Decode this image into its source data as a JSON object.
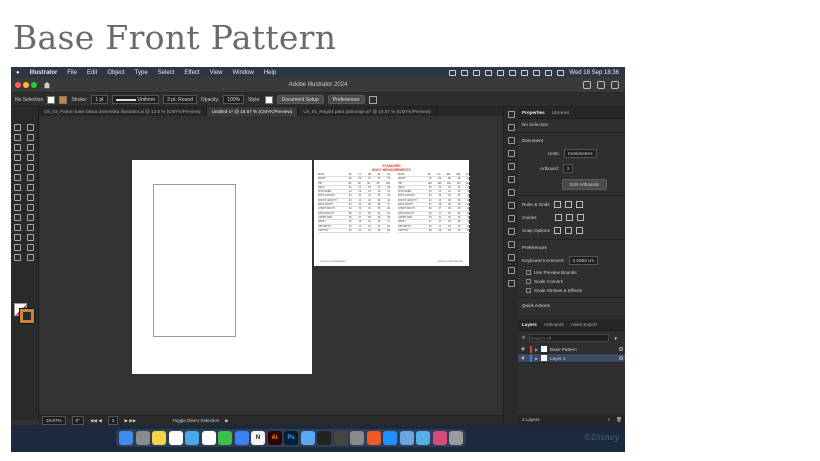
{
  "slide": {
    "title": "Base Front Pattern"
  },
  "menubar": {
    "app_name": "Illustrator",
    "items": [
      "File",
      "Edit",
      "Object",
      "Type",
      "Select",
      "Effect",
      "View",
      "Window",
      "Help"
    ],
    "clock": "Wed 18 Sep  18:36"
  },
  "titlebar": {
    "title": "Adobe Illustrator 2024"
  },
  "controlbar": {
    "selection": "No Selection",
    "stroke_label": "Stroke:",
    "stroke_weight": "1 pt",
    "stroke_profile": "Uniform",
    "brush": "3 pt. Round",
    "opacity_label": "Opacity:",
    "opacity": "100%",
    "style_label": "Style:",
    "document_setup": "Document Setup",
    "preferences": "Preferences"
  },
  "tabs": [
    {
      "label": "U5_03_Patron base blusa domestika illustrator.ai @ 12.5 % (CMYK/Preview)",
      "active": false
    },
    {
      "label": "Untitled-1* @ 16.67 % (CMYK/Preview)",
      "active": true
    },
    {
      "label": "U4_01_Reglas para patronaje.ai* @ 16.67 % (CMYK/Preview)",
      "active": false
    }
  ],
  "artboard2": {
    "title_line1": "STANDARD",
    "title_line2": "BODY MEASUREMENTS",
    "left_rows": [
      [
        "BUST",
        "80",
        "84",
        "88",
        "92",
        "96"
      ],
      [
        "WAIST",
        "62",
        "66",
        "70",
        "74",
        "78"
      ],
      [
        "HIP",
        "86",
        "90",
        "94",
        "98",
        "102"
      ],
      [
        "NECK",
        "34",
        "35",
        "36",
        "37",
        "38"
      ],
      [
        "SHOULDER",
        "12",
        "12",
        "13",
        "13",
        "13"
      ],
      [
        "BACK LENGTH",
        "40",
        "41",
        "41",
        "42",
        "42"
      ],
      [
        "FRONT LENGTH",
        "42",
        "43",
        "43",
        "44",
        "44"
      ],
      [
        "BACK WIDTH",
        "33",
        "34",
        "35",
        "36",
        "37"
      ],
      [
        "CHEST WIDTH",
        "32",
        "33",
        "34",
        "35",
        "36"
      ],
      [
        "ARM LENGTH",
        "58",
        "59",
        "60",
        "61",
        "62"
      ],
      [
        "UPPER ARM",
        "26",
        "27",
        "28",
        "29",
        "30"
      ],
      [
        "WRIST",
        "15",
        "15",
        "16",
        "16",
        "17"
      ],
      [
        "HIP DEPTH",
        "20",
        "20",
        "21",
        "21",
        "22"
      ],
      [
        "CROTCH",
        "26",
        "27",
        "27",
        "28",
        "28"
      ]
    ],
    "right_rows": [
      [
        "BUST",
        "96",
        "100",
        "104",
        "108",
        "112"
      ],
      [
        "WAIST",
        "78",
        "82",
        "86",
        "90",
        "94"
      ],
      [
        "HIP",
        "102",
        "106",
        "110",
        "114",
        "118"
      ],
      [
        "NECK",
        "38",
        "39",
        "40",
        "41",
        "42"
      ],
      [
        "SHOULDER",
        "13",
        "14",
        "14",
        "14",
        "15"
      ],
      [
        "BACK LENGTH",
        "42",
        "43",
        "43",
        "44",
        "44"
      ],
      [
        "FRONT LENGTH",
        "44",
        "45",
        "45",
        "46",
        "46"
      ],
      [
        "BACK WIDTH",
        "37",
        "38",
        "39",
        "40",
        "41"
      ],
      [
        "CHEST WIDTH",
        "36",
        "37",
        "38",
        "39",
        "40"
      ],
      [
        "ARM LENGTH",
        "62",
        "62",
        "63",
        "63",
        "64"
      ],
      [
        "UPPER ARM",
        "30",
        "31",
        "32",
        "33",
        "34"
      ],
      [
        "WRIST",
        "17",
        "17",
        "18",
        "18",
        "19"
      ],
      [
        "HIP DEPTH",
        "22",
        "22",
        "23",
        "23",
        "24"
      ],
      [
        "CROTCH",
        "28",
        "29",
        "29",
        "30",
        "30"
      ]
    ],
    "footer_left": "SIZES IN CENTIMETERS",
    "footer_right": "SIZES IN CENTIMETERS"
  },
  "statusbar": {
    "zoom": "16.67%",
    "rotation": "0°",
    "artboard_num": "2",
    "tool": "Toggle Direct Selection"
  },
  "properties": {
    "tab_properties": "Properties",
    "tab_libraries": "Libraries",
    "no_selection": "No Selection",
    "document": "Document",
    "units_label": "Units:",
    "units_value": "Centimeters",
    "artboard_label": "Artboard:",
    "artboard_value": "2",
    "edit_artboards": "Edit Artboards",
    "ruler_grids": "Ruler & Grids",
    "guides": "Guides",
    "snap_options": "Snap Options",
    "preferences": "Preferences",
    "keyboard_increment_label": "Keyboard Increment:",
    "keyboard_increment_value": "0.0353 cm",
    "use_preview_bounds": "Use Preview Bounds",
    "scale_corners": "Scale Corners",
    "scale_strokes": "Scale Strokes & Effects",
    "quick_actions": "Quick Actions"
  },
  "layers": {
    "tab_layers": "Layers",
    "tab_artboards": "Artboards",
    "tab_asset_export": "Asset Export",
    "search_placeholder": "Search All",
    "items": [
      {
        "name": "Base Pattern",
        "color": "#e03c31"
      },
      {
        "name": "Layer 1",
        "color": "#4a7bd8"
      }
    ],
    "count": "2 Layers"
  },
  "dock": {
    "apps": [
      {
        "icon": "finder-icon",
        "color": "#3f8cf0",
        "glyph": ""
      },
      {
        "icon": "launchpad-icon",
        "color": "#8a8a8a",
        "glyph": ""
      },
      {
        "icon": "notes-icon",
        "color": "#f5d24a",
        "glyph": ""
      },
      {
        "icon": "photos-icon",
        "color": "#ffffff",
        "glyph": ""
      },
      {
        "icon": "reminders-icon",
        "color": "#4aa8e8",
        "glyph": ""
      },
      {
        "icon": "calendar-icon",
        "color": "#ffffff",
        "glyph": ""
      },
      {
        "icon": "numbers-icon",
        "color": "#3cbf4e",
        "glyph": ""
      },
      {
        "icon": "keynote-icon",
        "color": "#3b82f6",
        "glyph": ""
      },
      {
        "icon": "notion-icon",
        "color": "#f4f4f4",
        "glyph": "N"
      },
      {
        "icon": "illustrator-icon",
        "color": "#330000",
        "glyph": "Ai"
      },
      {
        "icon": "photoshop-icon",
        "color": "#001e36",
        "glyph": "Ps"
      },
      {
        "icon": "safari-icon",
        "color": "#5aa7f5",
        "glyph": ""
      },
      {
        "icon": "terminal-icon",
        "color": "#222222",
        "glyph": ""
      },
      {
        "icon": "activity-icon",
        "color": "#444444",
        "glyph": ""
      },
      {
        "icon": "system-settings-icon",
        "color": "#8a8a8a",
        "glyph": ""
      },
      {
        "icon": "brave-icon",
        "color": "#f15a24",
        "glyph": ""
      },
      {
        "icon": "app-store-icon",
        "color": "#1e90ff",
        "glyph": ""
      },
      {
        "icon": "preview-icon",
        "color": "#6aa6e0",
        "glyph": ""
      },
      {
        "icon": "folder-icon",
        "color": "#55aee8",
        "glyph": ""
      },
      {
        "icon": "downloads-icon",
        "color": "#d94b7a",
        "glyph": ""
      },
      {
        "icon": "trash-icon",
        "color": "#9a9a9a",
        "glyph": ""
      }
    ]
  },
  "watermark": "©Disney"
}
